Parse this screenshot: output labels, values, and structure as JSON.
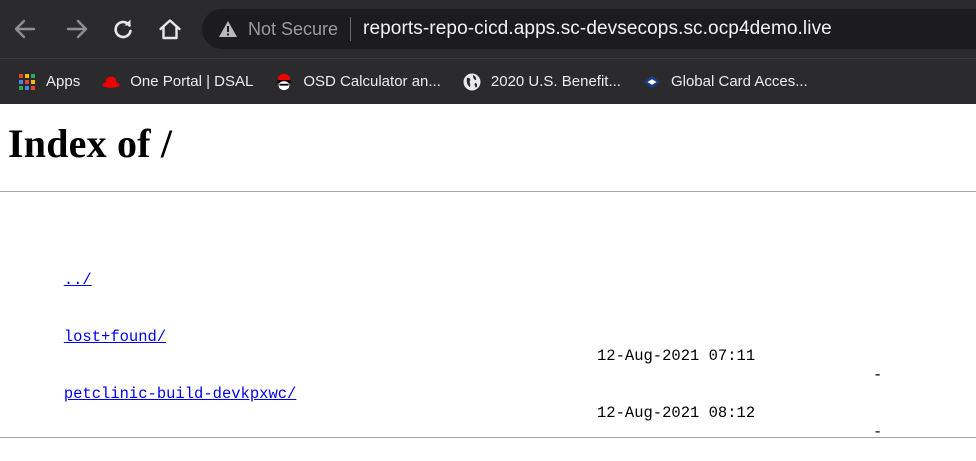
{
  "browser": {
    "security_label": "Not Secure",
    "url": "reports-repo-cicd.apps.sc-devsecops.sc.ocp4demo.live",
    "bookmarks": [
      {
        "label": "Apps",
        "icon": "apps-grid-icon"
      },
      {
        "label": "One Portal | DSAL",
        "icon": "redhat-hat-icon"
      },
      {
        "label": "OSD Calculator an...",
        "icon": "redhat-shadowman-icon"
      },
      {
        "label": "2020 U.S. Benefit...",
        "icon": "globe-icon"
      },
      {
        "label": "Global Card Acces...",
        "icon": "card-access-icon"
      }
    ]
  },
  "page": {
    "title": "Index of /",
    "entries": [
      {
        "name": "../",
        "date": "",
        "size": ""
      },
      {
        "name": "lost+found/",
        "date": "12-Aug-2021 07:11",
        "size": "-"
      },
      {
        "name": "petclinic-build-devkpxwc/",
        "date": "12-Aug-2021 08:12",
        "size": "-"
      }
    ]
  },
  "colors": {
    "chrome_bg": "#2b2b2d",
    "omnibox_bg": "#1c1c1e",
    "link": "#0000ee"
  }
}
